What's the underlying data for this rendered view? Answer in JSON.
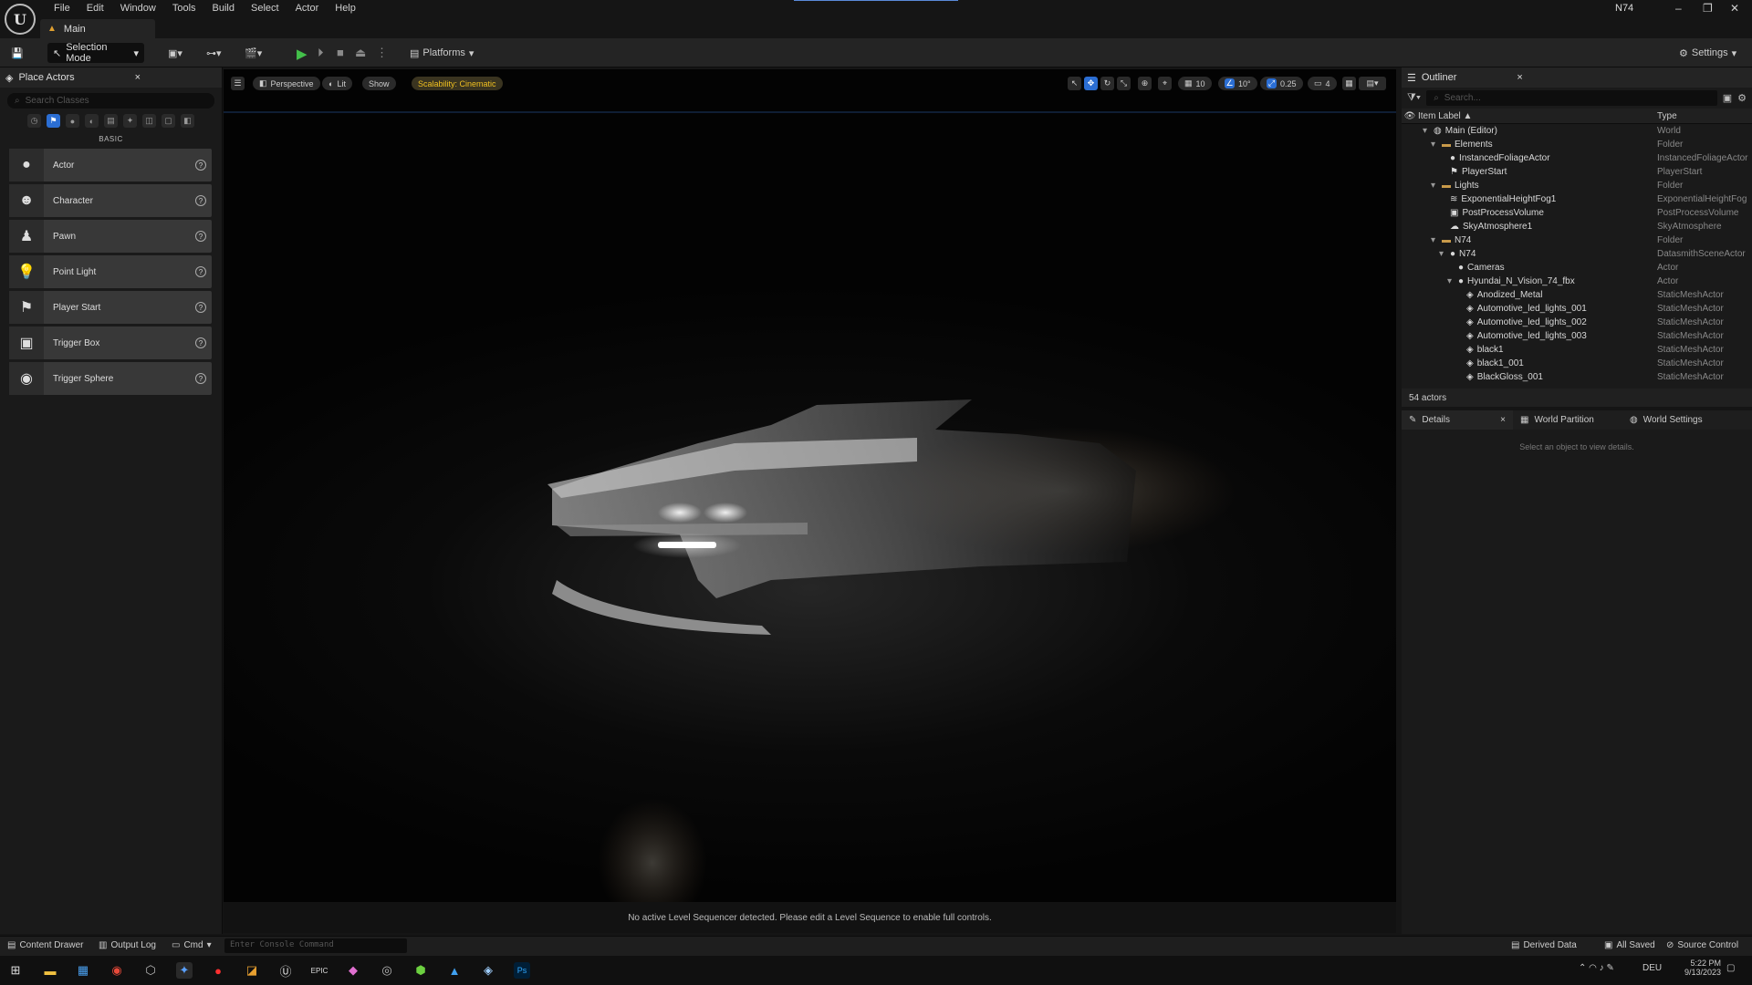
{
  "window": {
    "project_name": "N74",
    "doc_tab": "Main",
    "menu": [
      "File",
      "Edit",
      "Window",
      "Tools",
      "Build",
      "Select",
      "Actor",
      "Help"
    ],
    "controls": {
      "minimize": "–",
      "maximize": "❐",
      "close": "✕"
    }
  },
  "toolbar": {
    "selection_mode": "Selection Mode",
    "platforms": "Platforms",
    "settings": "Settings"
  },
  "place_actors": {
    "tab_label": "Place Actors",
    "search_placeholder": "Search Classes",
    "section": "BASIC",
    "items": [
      {
        "label": "Actor",
        "icon": "sphere-icon"
      },
      {
        "label": "Character",
        "icon": "character-icon"
      },
      {
        "label": "Pawn",
        "icon": "pawn-icon"
      },
      {
        "label": "Point Light",
        "icon": "point-light-icon"
      },
      {
        "label": "Player Start",
        "icon": "player-start-icon"
      },
      {
        "label": "Trigger Box",
        "icon": "trigger-box-icon"
      },
      {
        "label": "Trigger Sphere",
        "icon": "trigger-sphere-icon"
      }
    ]
  },
  "viewport": {
    "perspective": "Perspective",
    "lit": "Lit",
    "show": "Show",
    "scalability": "Scalability: Cinematic",
    "grid_snap": "10",
    "rotation_snap": "10°",
    "scale_snap": "0.25",
    "camera_speed": "4",
    "sequencer_message": "No active Level Sequencer detected. Please edit a Level Sequence to enable full controls."
  },
  "outliner": {
    "tab_label": "Outliner",
    "search_placeholder": "Search...",
    "col_label": "Item Label ▲",
    "col_type": "Type",
    "rows": [
      {
        "label": "Main (Editor)",
        "type": "World",
        "indent": 1,
        "icon": "world-icon",
        "expand": "▾"
      },
      {
        "label": "Elements",
        "type": "Folder",
        "indent": 2,
        "icon": "folder-icon",
        "expand": "▾"
      },
      {
        "label": "InstancedFoliageActor",
        "type": "InstancedFoliageActor",
        "indent": 3,
        "icon": "actor-icon",
        "expand": ""
      },
      {
        "label": "PlayerStart",
        "type": "PlayerStart",
        "indent": 3,
        "icon": "flag-icon",
        "expand": ""
      },
      {
        "label": "Lights",
        "type": "Folder",
        "indent": 2,
        "icon": "folder-icon",
        "expand": "▾"
      },
      {
        "label": "ExponentialHeightFog1",
        "type": "ExponentialHeightFog",
        "indent": 3,
        "icon": "fog-icon",
        "expand": ""
      },
      {
        "label": "PostProcessVolume",
        "type": "PostProcessVolume",
        "indent": 3,
        "icon": "volume-icon",
        "expand": ""
      },
      {
        "label": "SkyAtmosphere1",
        "type": "SkyAtmosphere",
        "indent": 3,
        "icon": "sky-icon",
        "expand": ""
      },
      {
        "label": "N74",
        "type": "Folder",
        "indent": 2,
        "icon": "folder-icon",
        "expand": "▾"
      },
      {
        "label": "N74",
        "type": "DatasmithSceneActor",
        "indent": 3,
        "icon": "actor-icon",
        "expand": "▾"
      },
      {
        "label": "Cameras",
        "type": "Actor",
        "indent": 4,
        "icon": "actor-icon",
        "expand": ""
      },
      {
        "label": "Hyundai_N_Vision_74_fbx",
        "type": "Actor",
        "indent": 4,
        "icon": "actor-icon",
        "expand": "▾"
      },
      {
        "label": "Anodized_Metal",
        "type": "StaticMeshActor",
        "indent": 5,
        "icon": "mesh-icon",
        "expand": ""
      },
      {
        "label": "Automotive_led_lights_001",
        "type": "StaticMeshActor",
        "indent": 5,
        "icon": "mesh-icon",
        "expand": ""
      },
      {
        "label": "Automotive_led_lights_002",
        "type": "StaticMeshActor",
        "indent": 5,
        "icon": "mesh-icon",
        "expand": ""
      },
      {
        "label": "Automotive_led_lights_003",
        "type": "StaticMeshActor",
        "indent": 5,
        "icon": "mesh-icon",
        "expand": ""
      },
      {
        "label": "black1",
        "type": "StaticMeshActor",
        "indent": 5,
        "icon": "mesh-icon",
        "expand": ""
      },
      {
        "label": "black1_001",
        "type": "StaticMeshActor",
        "indent": 5,
        "icon": "mesh-icon",
        "expand": ""
      },
      {
        "label": "BlackGloss_001",
        "type": "StaticMeshActor",
        "indent": 5,
        "icon": "mesh-icon",
        "expand": ""
      }
    ],
    "actor_count": "54 actors"
  },
  "details": {
    "tabs": [
      "Details",
      "World Partition",
      "World Settings"
    ],
    "empty_message": "Select an object to view details."
  },
  "bottombar": {
    "content_drawer": "Content Drawer",
    "output_log": "Output Log",
    "cmd": "Cmd",
    "console_placeholder": "Enter Console Command",
    "derived_data": "Derived Data",
    "all_saved": "All Saved",
    "source_control": "Source Control"
  },
  "taskbar": {
    "lang": "DEU",
    "time": "5:22 PM",
    "date": "9/13/2023"
  }
}
